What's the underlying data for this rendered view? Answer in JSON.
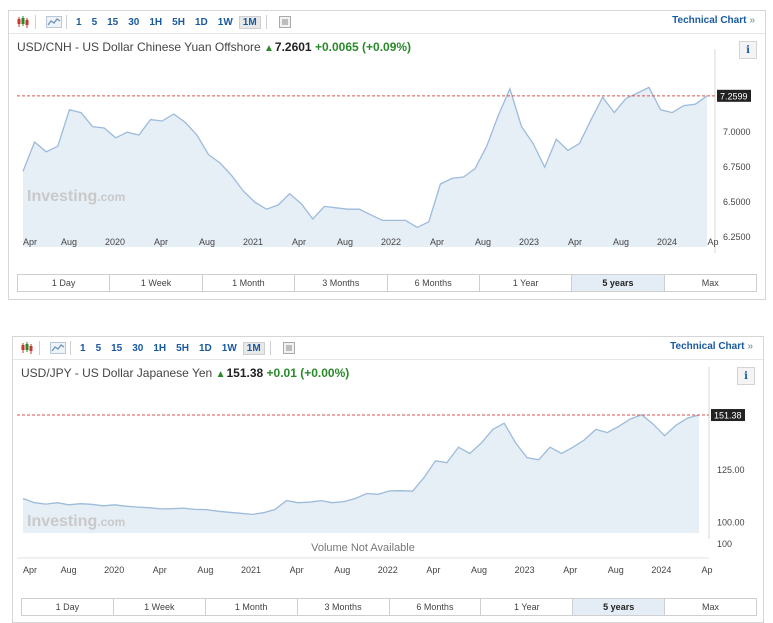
{
  "toolbar": {
    "intervals": [
      "1",
      "5",
      "15",
      "30",
      "1H",
      "5H",
      "1D",
      "1W",
      "1M"
    ],
    "active_interval": "1M",
    "technical_chart_label": "Technical Chart",
    "technical_chart_arrow": "»",
    "icons": [
      "candlestick-icon",
      "line-chart-icon",
      "settings-panel-icon"
    ]
  },
  "colors": {
    "link": "#1a5aa0",
    "positive": "#2a8a2a",
    "area_fill": "#e6eef6",
    "line": "#9dbbdb",
    "last_price_line": "#d9534f"
  },
  "periods": [
    "1 Day",
    "1 Week",
    "1 Month",
    "3 Months",
    "6 Months",
    "1 Year",
    "5 years",
    "Max"
  ],
  "active_period": "5 years",
  "watermark": {
    "brand": "Investing",
    "suffix": ".com"
  },
  "charts": {
    "cnh": {
      "title": "USD/CNH - US Dollar Chinese Yuan Offshore",
      "price": "7.2601",
      "change": "+0.0065",
      "change_pct": "(+0.09%)",
      "last_label": "7.2599",
      "info_label": "i"
    },
    "jpy": {
      "title": "USD/JPY - US Dollar Japanese Yen",
      "price": "151.38",
      "change": "+0.01",
      "change_pct": "(+0.00%)",
      "last_label": "151.38",
      "info_label": "i",
      "volume_label": "Volume Not Available",
      "volume_axis": "100"
    }
  },
  "chart_data": [
    {
      "type": "area",
      "title": "USD/CNH - US Dollar Chinese Yuan Offshore",
      "x_tick_labels": [
        "Apr",
        "Aug",
        "2020",
        "Apr",
        "Aug",
        "2021",
        "Apr",
        "Aug",
        "2022",
        "Apr",
        "Aug",
        "2023",
        "Apr",
        "Aug",
        "2024",
        "Ap"
      ],
      "y_tick_labels": [
        "6.2500",
        "6.5000",
        "6.7500",
        "7.0000"
      ],
      "ylim": [
        6.18,
        7.38
      ],
      "last_value": 7.2599,
      "series": [
        {
          "values": [
            6.72,
            6.93,
            6.86,
            6.9,
            7.16,
            7.14,
            7.04,
            7.03,
            6.96,
            7.0,
            6.98,
            7.09,
            7.08,
            7.13,
            7.07,
            6.98,
            6.84,
            6.78,
            6.69,
            6.58,
            6.5,
            6.45,
            6.48,
            6.56,
            6.49,
            6.38,
            6.47,
            6.46,
            6.45,
            6.45,
            6.41,
            6.37,
            6.37,
            6.37,
            6.32,
            6.36,
            6.63,
            6.67,
            6.68,
            6.74,
            6.9,
            7.12,
            7.31,
            7.04,
            6.92,
            6.75,
            6.95,
            6.87,
            6.92,
            7.09,
            7.25,
            7.14,
            7.24,
            7.28,
            7.32,
            7.16,
            7.14,
            7.19,
            7.2,
            7.26
          ]
        }
      ]
    },
    {
      "type": "area",
      "title": "USD/JPY - US Dollar Japanese Yen",
      "x_tick_labels": [
        "Apr",
        "Aug",
        "2020",
        "Apr",
        "Aug",
        "2021",
        "Apr",
        "Aug",
        "2022",
        "Apr",
        "Aug",
        "2023",
        "Apr",
        "Aug",
        "2024",
        "Ap"
      ],
      "y_tick_labels": [
        "100.00",
        "125.00"
      ],
      "ylim": [
        95,
        160
      ],
      "last_value": 151.38,
      "series": [
        {
          "values": [
            111.5,
            109.5,
            108.8,
            109.5,
            108.5,
            109.0,
            108.7,
            108.0,
            108.5,
            107.8,
            107.4,
            107.1,
            106.5,
            106.6,
            106.9,
            106.3,
            106.2,
            105.4,
            104.9,
            104.4,
            103.9,
            104.7,
            106.3,
            110.5,
            109.5,
            109.7,
            110.5,
            109.5,
            110.0,
            111.5,
            113.9,
            113.5,
            115.1,
            115.2,
            115.0,
            121.5,
            129.5,
            128.6,
            136.0,
            133.0,
            138.0,
            144.5,
            147.5,
            138.0,
            131.0,
            130.0,
            136.0,
            133.0,
            136.0,
            139.5,
            144.5,
            143.0,
            146.0,
            149.5,
            151.5,
            147.0,
            141.5,
            146.5,
            149.9,
            151.38
          ]
        }
      ]
    }
  ]
}
